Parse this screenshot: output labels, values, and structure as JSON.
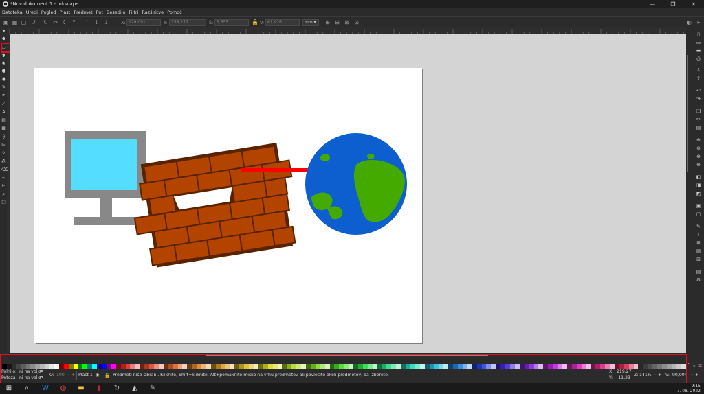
{
  "window": {
    "title": "*Nov dokument 1 - Inkscape",
    "controls": {
      "minimize": "—",
      "restore": "❐",
      "close": "✕"
    }
  },
  "menu": [
    "Datoteka",
    "Uredi",
    "Pogled",
    "Plast",
    "Predmet",
    "Pot",
    "Besedilo",
    "Filtri",
    "Razširitve",
    "Pomoč"
  ],
  "toolbar": {
    "x_label": "X:",
    "x_value": "129,091",
    "y_label": "Y:",
    "y_value": "158,277",
    "w_label": "Š:",
    "w_value": "3,555",
    "h_label": "V:",
    "h_value": "61,926",
    "unit": "mm"
  },
  "statusbar": {
    "fill_label": "Polnilo:",
    "fill_value": "ni na voljo",
    "stroke_label": "Poteza:",
    "stroke_value": "ni na voljo",
    "opacity_label": "O:",
    "opacity_value": "100",
    "layer": "Plast 1",
    "message": "Predmeti niso izbrani. Kliknite, Shift+kliknite, Alt+pomaknite miško na vrhu predmetov ali povlecite okoli predmetov, da izberete.",
    "cursor_x_label": "X:",
    "cursor_x": "219,27",
    "cursor_y_label": "Y:",
    "cursor_y": "-11,23",
    "zoom_label": "Z:",
    "zoom": "141%",
    "rotation_label": "V:",
    "rotation": "90,00°"
  },
  "taskbar": {
    "time": "9:15",
    "date": "7. 08. 2022"
  },
  "colors": {
    "monitor_frame": "#888888",
    "monitor_screen": "#55ddff",
    "brick": "#b34400",
    "mortar": "#5a2300",
    "globe_ocean": "#0d5fcf",
    "globe_land": "#44aa00",
    "laser": "#ff0000",
    "highlight": "#e01020"
  },
  "icons": {
    "app": "inkscape-icon",
    "selector_tool": "arrow-icon",
    "rectangle_tool": "rectangle-icon",
    "start": "windows-start-icon",
    "search": "search-icon"
  }
}
